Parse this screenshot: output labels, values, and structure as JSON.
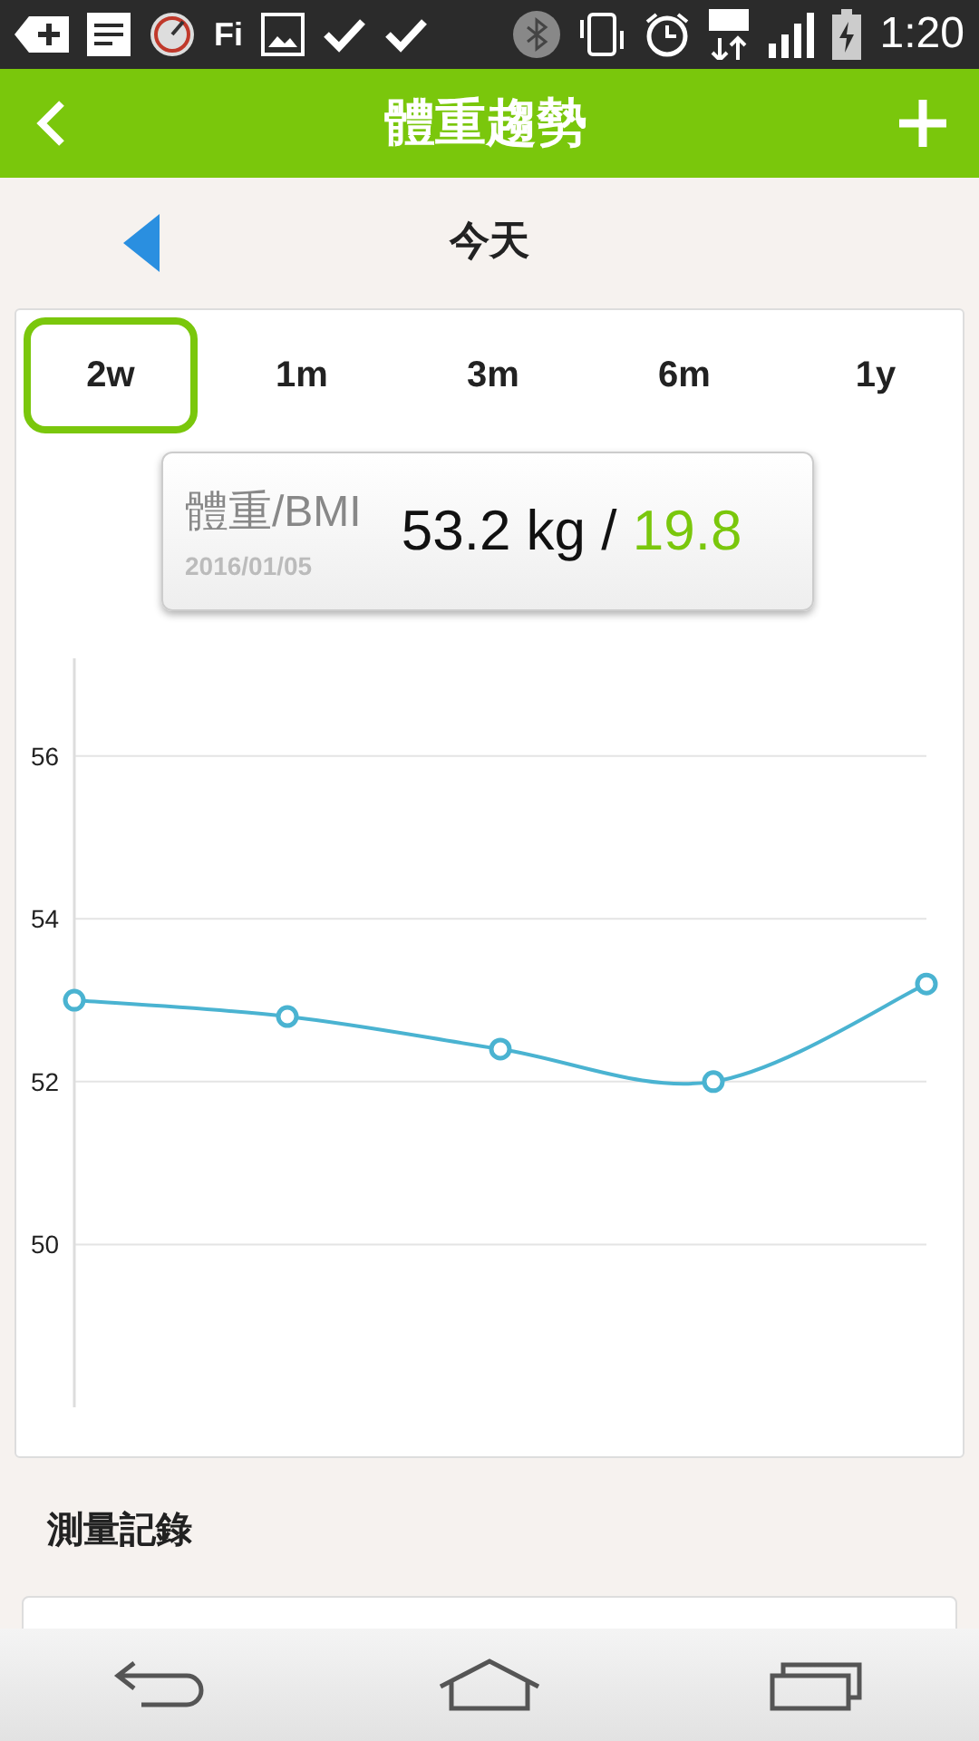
{
  "status_bar": {
    "fi_label": "Fi",
    "time": "1:20"
  },
  "app_bar": {
    "title": "體重趨勢"
  },
  "date_nav": {
    "label": "今天"
  },
  "range_tabs": [
    {
      "label": "2w",
      "selected": true
    },
    {
      "label": "1m",
      "selected": false
    },
    {
      "label": "3m",
      "selected": false
    },
    {
      "label": "6m",
      "selected": false
    },
    {
      "label": "1y",
      "selected": false
    }
  ],
  "tooltip": {
    "label": "體重/BMI",
    "date": "2016/01/05",
    "weight": "53.2 kg /",
    "bmi": "19.8"
  },
  "chart_data": {
    "type": "line",
    "grid": true,
    "ylim": [
      48,
      57.2
    ],
    "yticks": [
      50,
      52,
      54,
      56
    ],
    "series": [
      {
        "color": "#4ab3d1",
        "marker": true,
        "values": [
          53.0,
          52.8,
          52.4,
          52.0,
          53.2
        ]
      }
    ]
  },
  "records": {
    "heading": "測量記錄"
  }
}
